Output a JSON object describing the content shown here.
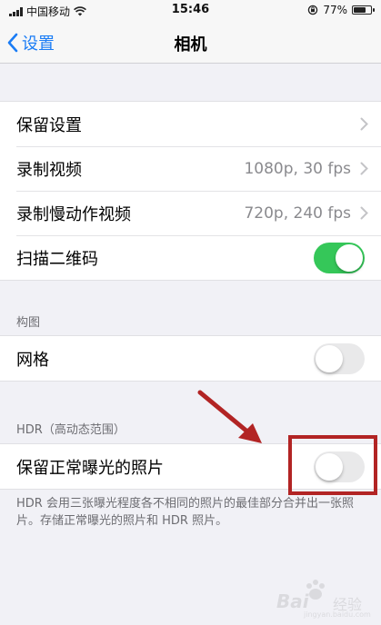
{
  "status_bar": {
    "carrier": "中国移动",
    "time": "15:46",
    "battery": "77%",
    "battery_level": 0.77
  },
  "nav": {
    "back_label": "设置",
    "title": "相机"
  },
  "group1": {
    "items": [
      {
        "label": "保留设置",
        "value": ""
      },
      {
        "label": "录制视频",
        "value": "1080p, 30 fps"
      },
      {
        "label": "录制慢动作视频",
        "value": "720p, 240 fps"
      },
      {
        "label": "扫描二维码",
        "toggle": true
      }
    ]
  },
  "composition": {
    "header": "构图",
    "items": [
      {
        "label": "网格",
        "toggle": false
      }
    ]
  },
  "hdr": {
    "header": "HDR（高动态范围）",
    "items": [
      {
        "label": "保留正常曝光的照片",
        "toggle": false
      }
    ],
    "footer": "HDR 会用三张曝光程度各不相同的照片的最佳部分合并出一张照片。存储正常曝光的照片和 HDR 照片。"
  },
  "watermark": {
    "brand": "Bai",
    "sub": "经验",
    "url": "jingyan.baidu.com"
  },
  "colors": {
    "accent": "#1a7cf5",
    "toggle_on": "#35c759",
    "annotation": "#b22424"
  }
}
